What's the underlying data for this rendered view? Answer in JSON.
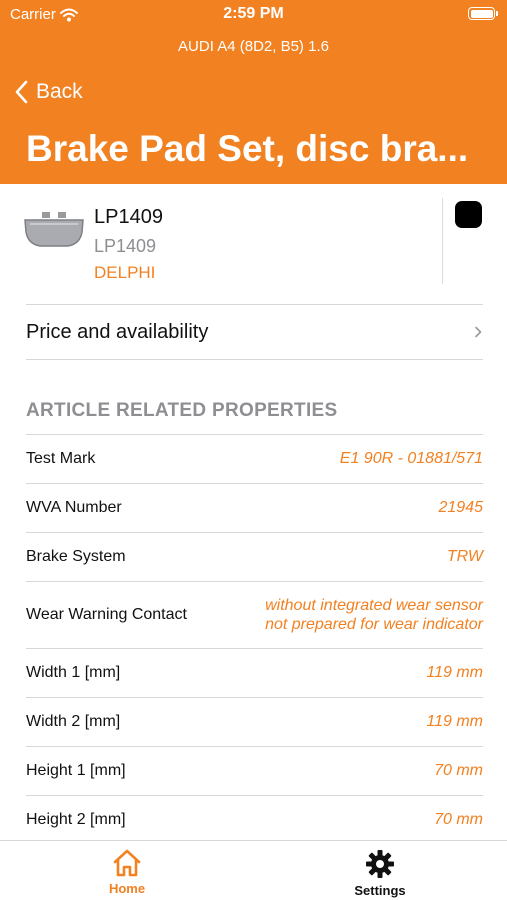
{
  "status_bar": {
    "carrier": "Carrier",
    "time": "2:59 PM"
  },
  "header": {
    "vehicle": "AUDI A4 (8D2, B5) 1.6",
    "back_label": "Back",
    "title": "Brake Pad Set, disc bra..."
  },
  "article": {
    "number": "LP1409",
    "sub_number": "LP1409",
    "brand": "DELPHI"
  },
  "price_row": {
    "label": "Price and availability"
  },
  "properties": {
    "section_title": "ARTICLE RELATED PROPERTIES",
    "rows": [
      {
        "name": "Test Mark",
        "value": "E1 90R - 01881/571"
      },
      {
        "name": "WVA Number",
        "value": "21945"
      },
      {
        "name": "Brake System",
        "value": "TRW"
      },
      {
        "name": "Wear Warning Contact",
        "value_line1": "without integrated wear sensor",
        "value_line2": "not prepared for wear indicator"
      },
      {
        "name": "Width 1 [mm]",
        "value": "119 mm"
      },
      {
        "name": "Width 2 [mm]",
        "value": "119 mm"
      },
      {
        "name": "Height 1 [mm]",
        "value": "70 mm"
      },
      {
        "name": "Height 2 [mm]",
        "value": "70 mm"
      }
    ]
  },
  "tabbar": {
    "home_label": "Home",
    "settings_label": "Settings",
    "active": "Home"
  },
  "colors": {
    "accent": "#f28122",
    "secondary_text": "#8e8e93"
  },
  "icons": [
    "wifi-icon",
    "battery-icon",
    "back-chevron-icon",
    "brake-pad-icon",
    "chevron-right-icon",
    "home-icon",
    "gear-icon"
  ]
}
